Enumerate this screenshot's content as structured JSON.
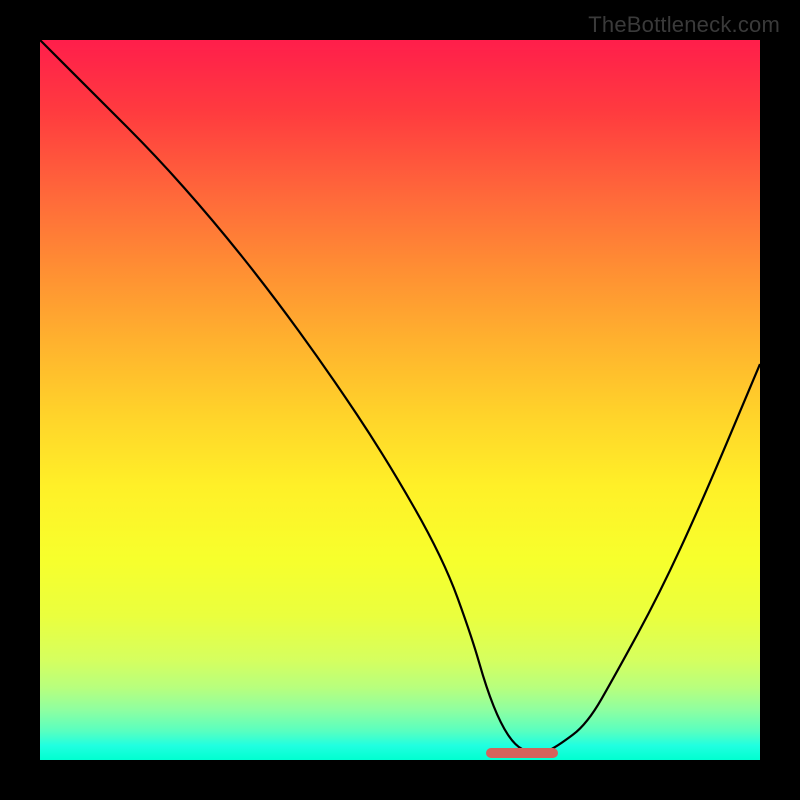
{
  "attribution": "TheBottleneck.com",
  "chart_data": {
    "type": "line",
    "title": "",
    "xlabel": "",
    "ylabel": "",
    "xlim": [
      0,
      100
    ],
    "ylim": [
      0,
      100
    ],
    "series": [
      {
        "name": "curve",
        "x": [
          0,
          8,
          16,
          24,
          32,
          40,
          48,
          56,
          60,
          62,
          64,
          66,
          68,
          70,
          72,
          76,
          80,
          86,
          92,
          100
        ],
        "y": [
          100,
          92,
          84,
          75,
          65,
          54,
          42,
          28,
          17,
          10,
          5,
          2,
          1,
          1,
          2,
          5,
          12,
          23,
          36,
          55
        ]
      }
    ],
    "highlight": {
      "x_start": 62,
      "x_end": 72,
      "y": 1
    },
    "colors": {
      "gradient_top": "#ff1e4b",
      "gradient_bottom": "#00ffd0",
      "curve": "#000000",
      "highlight": "#d4635c",
      "frame": "#000000"
    }
  }
}
